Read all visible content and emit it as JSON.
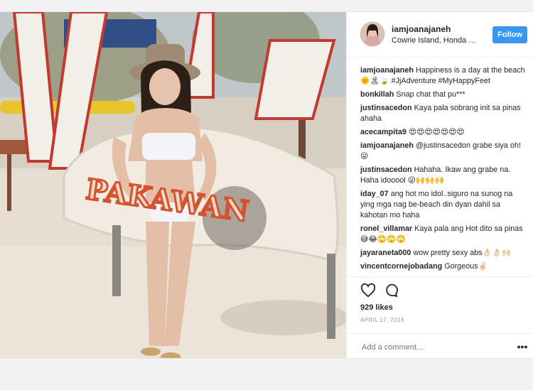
{
  "post": {
    "username": "iamjoanajaneh",
    "location": "Cowrie Island, Honda B...",
    "follow_label": "Follow",
    "photo_sign_text": "PAKAWAN"
  },
  "comments": [
    {
      "user": "iamjoanajaneh",
      "text": "Happiness is a day at the beach 🌞🏝🍃 #JjAdventure #MyHappyFeet"
    },
    {
      "user": "bonkillah",
      "text": "Snap chat that pu***"
    },
    {
      "user": "justinsacedon",
      "text": "Kaya pala sobrang init sa pinas ahaha"
    },
    {
      "user": "acecampita9",
      "text": "😍😍😍😍😍😍😍"
    },
    {
      "user": "iamjoanajaneh",
      "text": "@justinsacedon grabe siya oh! 😜"
    },
    {
      "user": "justinsacedon",
      "text": "Hahaha. Ikaw ang grabe na. Haha idooool 😜🙌🙌🙌"
    },
    {
      "user": "iday_07",
      "text": "ang hot mo idol..siguro na sunog na ying mga nag be-beach din dyan dahil sa kahotan mo haha"
    },
    {
      "user": "ronel_villamar",
      "text": "Kaya pala ang Hot dito sa pinas 😅😂🙄🙄🙄"
    },
    {
      "user": "jayaraneta000",
      "text": "wow pretty sexy abs👌🏻👌🏻🙌🏻"
    },
    {
      "user": "vincentcornejobadang",
      "text": "Gorgeous✌🏻"
    }
  ],
  "actions": {
    "likes": "929 likes",
    "date": "APRIL 17, 2016",
    "add_comment_placeholder": "Add a comment...",
    "more_label": "•••"
  },
  "icons": {
    "like": "heart-icon",
    "comment": "comment-bubble-icon",
    "more": "more-options-icon"
  },
  "colors": {
    "follow_button": "#3897f0",
    "text": "#262626",
    "muted": "#999999"
  }
}
